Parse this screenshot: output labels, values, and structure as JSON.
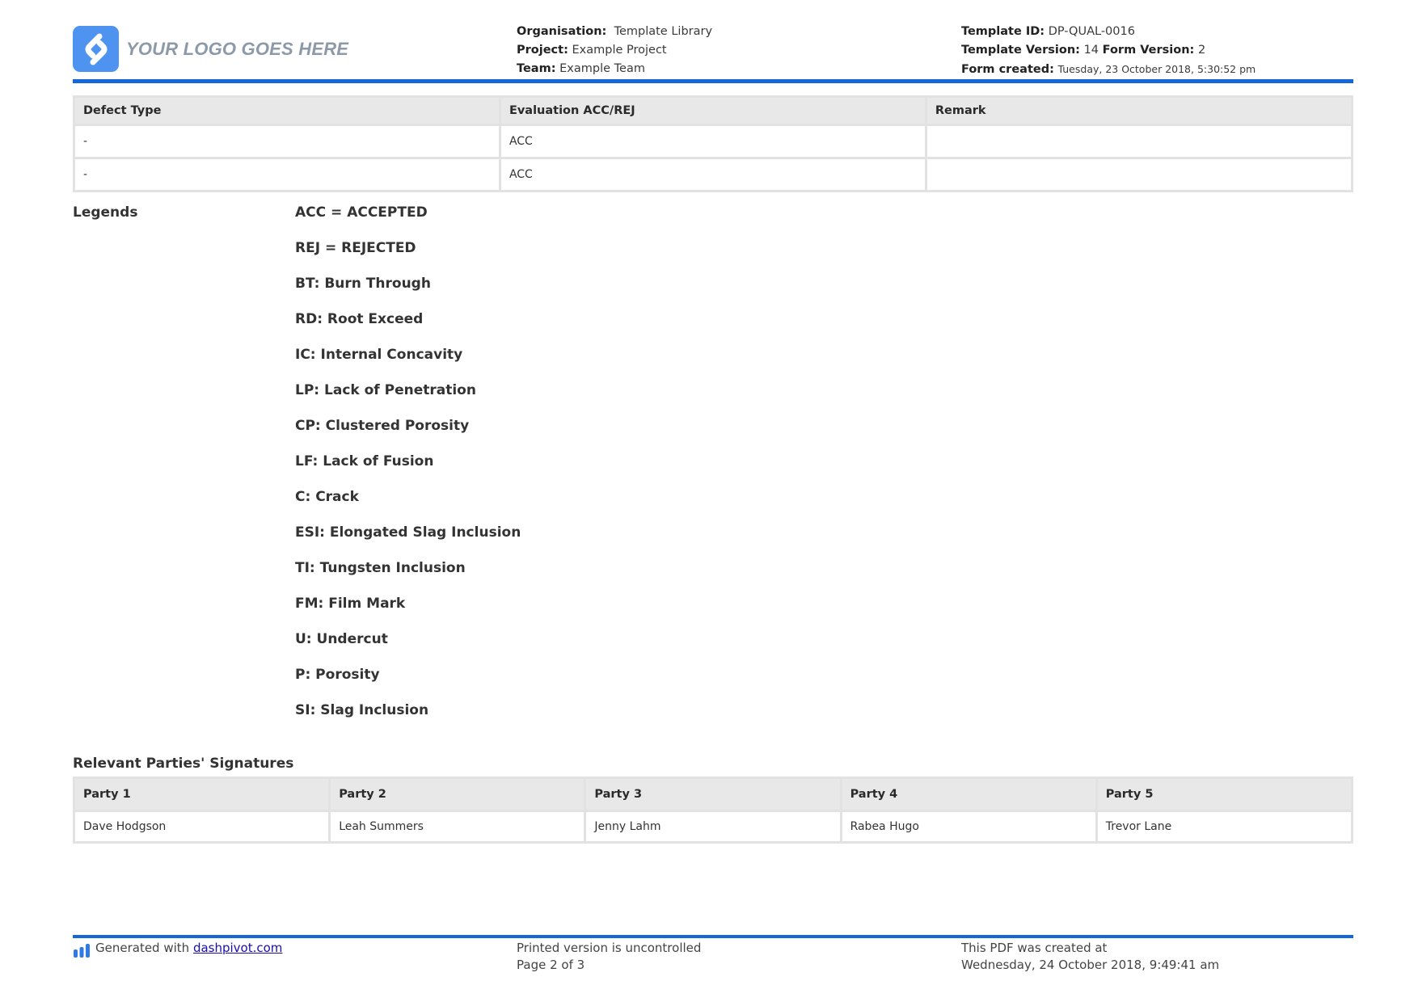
{
  "header": {
    "logo_text": "YOUR LOGO GOES HERE",
    "organisation_label": "Organisation:",
    "organisation_value": "Template Library",
    "project_label": "Project:",
    "project_value": "Example Project",
    "team_label": "Team:",
    "team_value": "Example Team",
    "template_id_label": "Template ID:",
    "template_id_value": "DP-QUAL-0016",
    "template_version_label": "Template Version:",
    "template_version_value": "14",
    "form_version_label": "Form Version:",
    "form_version_value": "2",
    "form_created_label": "Form created:",
    "form_created_value": "Tuesday, 23 October 2018, 5:30:52 pm"
  },
  "defects": {
    "columns": [
      "Defect Type",
      "Evaluation ACC/REJ",
      "Remark"
    ],
    "rows": [
      [
        "-",
        "ACC",
        ""
      ],
      [
        "-",
        "ACC",
        ""
      ]
    ]
  },
  "legends": {
    "label": "Legends",
    "items": [
      "ACC = ACCEPTED",
      "REJ = REJECTED",
      "BT: Burn Through",
      "RD: Root Exceed",
      "IC: Internal Concavity",
      "LP: Lack of Penetration",
      "CP: Clustered Porosity",
      "LF: Lack of Fusion",
      "C: Crack",
      "ESI: Elongated Slag Inclusion",
      "TI: Tungsten Inclusion",
      "FM: Film Mark",
      "U: Undercut",
      "P: Porosity",
      "SI: Slag Inclusion"
    ]
  },
  "signatures": {
    "heading": "Relevant Parties' Signatures",
    "columns": [
      "Party 1",
      "Party 2",
      "Party 3",
      "Party 4",
      "Party 5"
    ],
    "names": [
      "Dave Hodgson",
      "Leah Summers",
      "Jenny Lahm",
      "Rabea Hugo",
      "Trevor Lane"
    ]
  },
  "footer": {
    "generated_prefix": "Generated with",
    "generated_link": "dashpivot.com",
    "uncontrolled": "Printed version is uncontrolled",
    "page": "Page 2 of 3",
    "created_line1": "This PDF was created at",
    "created_line2": "Wednesday, 24 October 2018, 9:49:41 am"
  },
  "colors": {
    "accent": "#1467d6",
    "logo_blue": "#4f93f0",
    "header_cell": "#e8e8e8"
  },
  "icons": {
    "logo": "logo-icon",
    "footer": "dashpivot-bars-icon"
  }
}
